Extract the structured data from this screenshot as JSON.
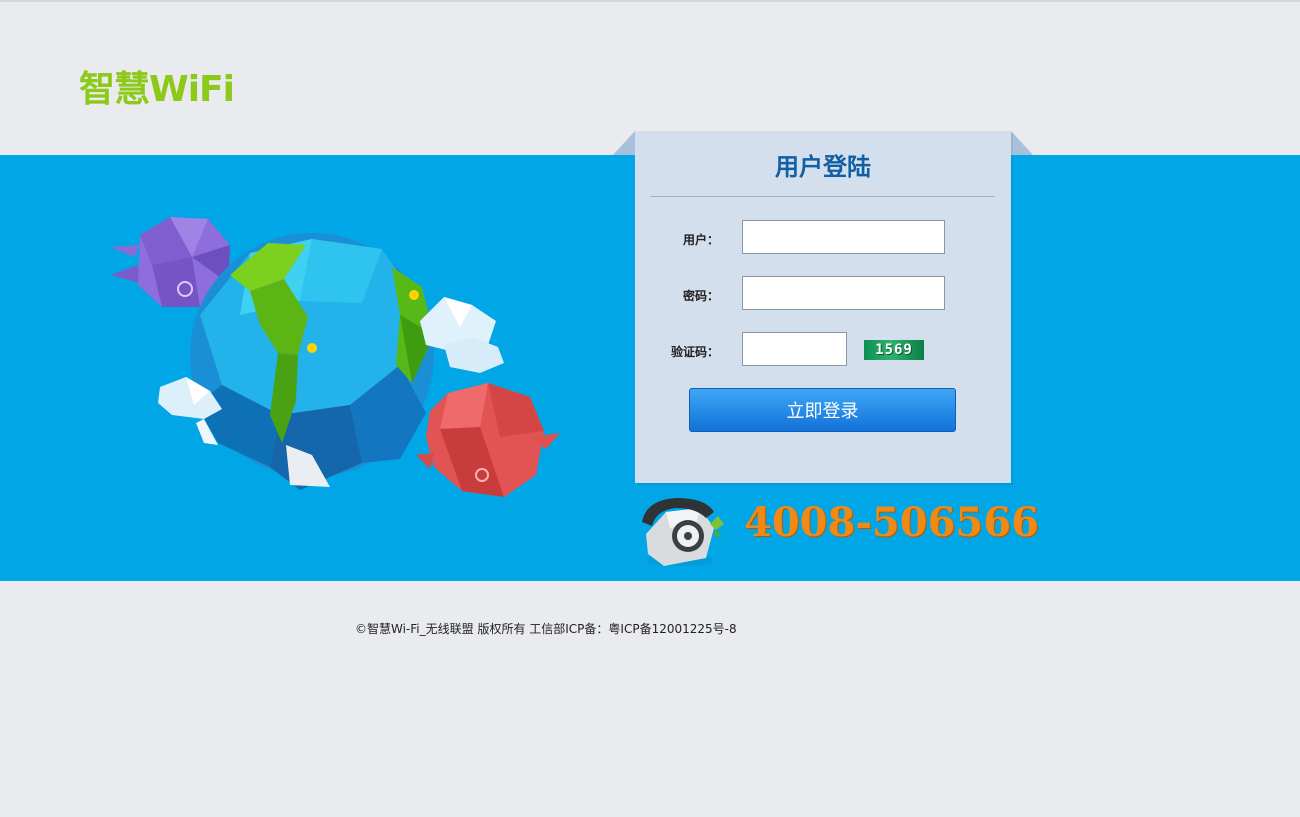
{
  "header": {
    "logo_text": "智慧WiFi"
  },
  "login": {
    "title": "用户登陆",
    "user_label": "用户：",
    "user_value": "",
    "password_label": "密码：",
    "password_value": "",
    "captcha_label": "验证码：",
    "captcha_value": "",
    "captcha_image_text": "1569",
    "submit_label": "立即登录"
  },
  "contact": {
    "phone": "4008-506566"
  },
  "footer": {
    "copyright": "©智慧Wi-Fi_无线联盟 版权所有 工信部ICP备：粤ICP备12001225号-8"
  },
  "colors": {
    "band": "#00a6e6",
    "page_bg": "#e9ebee",
    "panel_bg": "#d4dfee",
    "title": "#135fa3",
    "logo": "#8cc919",
    "phone": "#f08a17",
    "button": "#1b84e6"
  },
  "icons": {
    "illustration": "low-poly-globe-illustration",
    "phone": "telephone-icon"
  }
}
